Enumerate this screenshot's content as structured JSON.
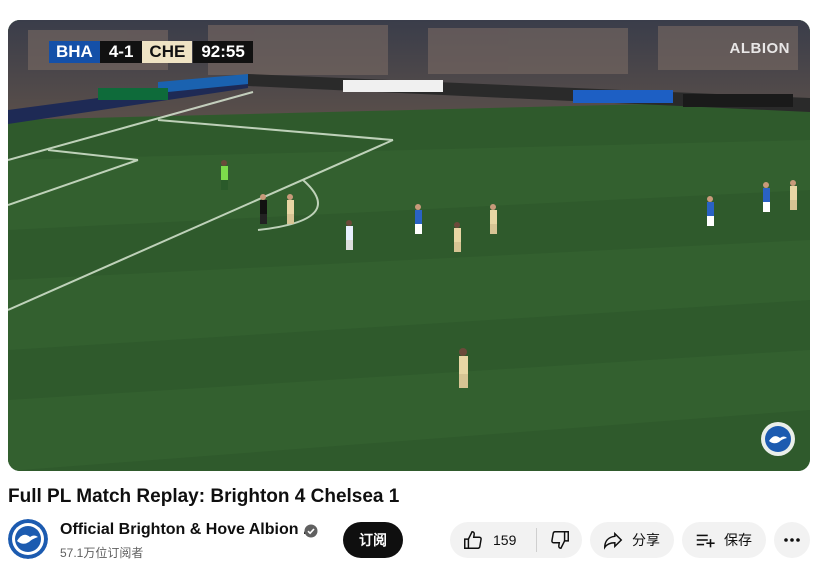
{
  "scorebug": {
    "home": "BHA",
    "score": "4-1",
    "away": "CHE",
    "clock": "92:55"
  },
  "player_watermark": "ALBION",
  "video": {
    "title": "Full PL Match Replay: Brighton 4 Chelsea 1"
  },
  "channel": {
    "name": "Official Brighton & Hove Albion ...",
    "subscribers": "57.1万位订阅者",
    "verified_icon": "verified-check-icon",
    "avatar_icon": "brighton-crest-icon"
  },
  "actions": {
    "subscribe_label": "订阅",
    "like_count": "159",
    "share_label": "分享",
    "save_label": "保存",
    "like_icon": "thumbs-up-icon",
    "dislike_icon": "thumbs-down-icon",
    "share_icon": "share-arrow-icon",
    "save_icon": "playlist-add-icon",
    "more_icon": "more-horizontal-icon"
  },
  "colors": {
    "subscribe_bg": "#0f0f0f",
    "pill_bg": "#f2f2f2",
    "home_team": "#1450a8",
    "away_team": "#efe3c4",
    "pitch": "#2f5a2c"
  }
}
